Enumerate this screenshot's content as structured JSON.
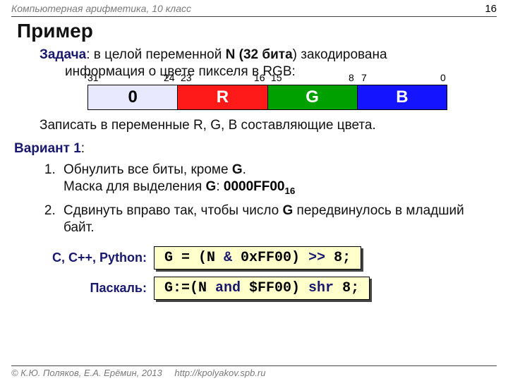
{
  "header": {
    "course": "Компьютерная арифметика, 10 класс",
    "page": "16"
  },
  "title": "Пример",
  "task": {
    "label": "Задача",
    "colon": ":",
    "l1a": "  в целой ",
    "l1b": "переменной",
    "l1c": " N (",
    "l1bits": "32 бита",
    "l1d": ") закодирована",
    "l2": "информация о цвете пикселя в RGB:"
  },
  "bits": {
    "n31": "31",
    "n24": "24",
    "n23": "23",
    "n16": "16",
    "n15": "15",
    "n8": "8",
    "n7": "7",
    "n0": "0",
    "c0": "0",
    "cR": "R",
    "cG": "G",
    "cB": "B"
  },
  "task_end": "Записать в переменные R, G, B составляющие цвета.",
  "variant": {
    "label": "Вариант 1",
    "colon": ":"
  },
  "steps": {
    "s1a": "Обнулить все биты, кроме ",
    "s1b": "G",
    "s1c": ".",
    "s1d": "Маска для выделения ",
    "s1e": "G",
    "s1f": ": ",
    "mask": "0000FF00",
    "mask_sub": "16",
    "s2a": "Сдвинуть вправо так, чтобы число ",
    "s2b": "G",
    "s2c": " передвинулось в младший байт."
  },
  "code": {
    "label_c": "С, С++, Python:",
    "label_pas": "Паскаль:",
    "c1a": "G = (N ",
    "c1b": "&",
    "c1c": " 0xFF00) ",
    "c1d": ">>",
    "c1e": " 8;",
    "p1a": "G:=(N ",
    "p1b": "and",
    "p1c": " $FF00) ",
    "p1d": "shr",
    "p1e": " 8;"
  },
  "footer": {
    "copyright": "© К.Ю. Поляков, Е.А. Ерёмин, 2013",
    "url": "http://kpolyakov.spb.ru"
  }
}
